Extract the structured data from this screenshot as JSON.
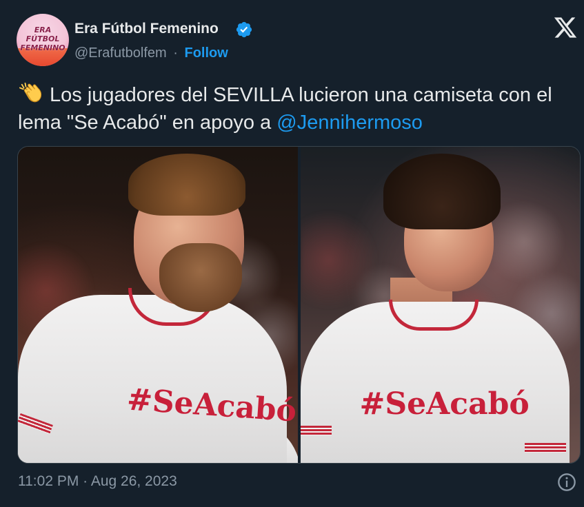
{
  "author": {
    "display_name": "Era Fútbol Femenino",
    "handle": "@Erafutbolfem",
    "separator": "·",
    "follow_label": "Follow",
    "verified": true,
    "avatar_logo_lines": [
      "ERA",
      "FÚTBOL",
      "FEMENINO"
    ]
  },
  "platform": {
    "logo_icon": "x-logo-icon"
  },
  "tweet": {
    "emoji_icon": "clapping-hands-icon",
    "text_main": "Los jugadores del SEVILLA lucieron una camiseta con el lema \"Se Acabó\" en apoyo a ",
    "mention": "@Jennihermoso"
  },
  "media": {
    "photos": [
      {
        "shirt_slogan": "#SeAcabó"
      },
      {
        "shirt_slogan": "#SeAcabó"
      }
    ]
  },
  "footer": {
    "timestamp": "11:02 PM · Aug 26, 2023",
    "info_icon": "info-icon"
  },
  "colors": {
    "background": "#15202b",
    "text_primary": "#e7e9ea",
    "text_secondary": "#8b98a5",
    "accent": "#1d9bf0",
    "shirt_red": "#c8203a"
  }
}
